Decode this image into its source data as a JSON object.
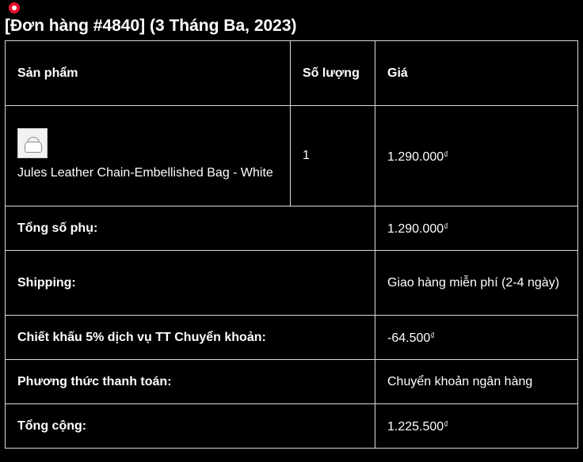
{
  "order": {
    "title": "[Đơn hàng #4840] (3 Tháng Ba, 2023)"
  },
  "table": {
    "headers": {
      "product": "Sản phẩm",
      "quantity": "Số lượng",
      "price": "Giá"
    },
    "items": [
      {
        "name": "Jules Leather Chain-Embellished Bag - White",
        "quantity": "1",
        "price": "1.290.000",
        "currency": "₫",
        "thumbnail_icon": "white-bag-thumbnail"
      }
    ],
    "totals": [
      {
        "label": "Tổng số phụ:",
        "value": "1.290.000",
        "currency": "₫"
      },
      {
        "label": "Shipping:",
        "value": "Giao hàng miễn phí (2-4 ngày)",
        "currency": ""
      },
      {
        "label": "Chiết khấu 5% dịch vụ TT Chuyển khoản:",
        "value": "-64.500",
        "currency": "₫"
      },
      {
        "label": "Phương thức thanh toán:",
        "value": "Chuyển khoản ngân hàng",
        "currency": ""
      },
      {
        "label": "Tổng cộng:",
        "value": "1.225.500",
        "currency": "₫"
      }
    ]
  },
  "colors": {
    "background": "#000000",
    "text": "#ffffff",
    "border": "#d9d9d9",
    "cursor_marker": "#e8102a"
  }
}
